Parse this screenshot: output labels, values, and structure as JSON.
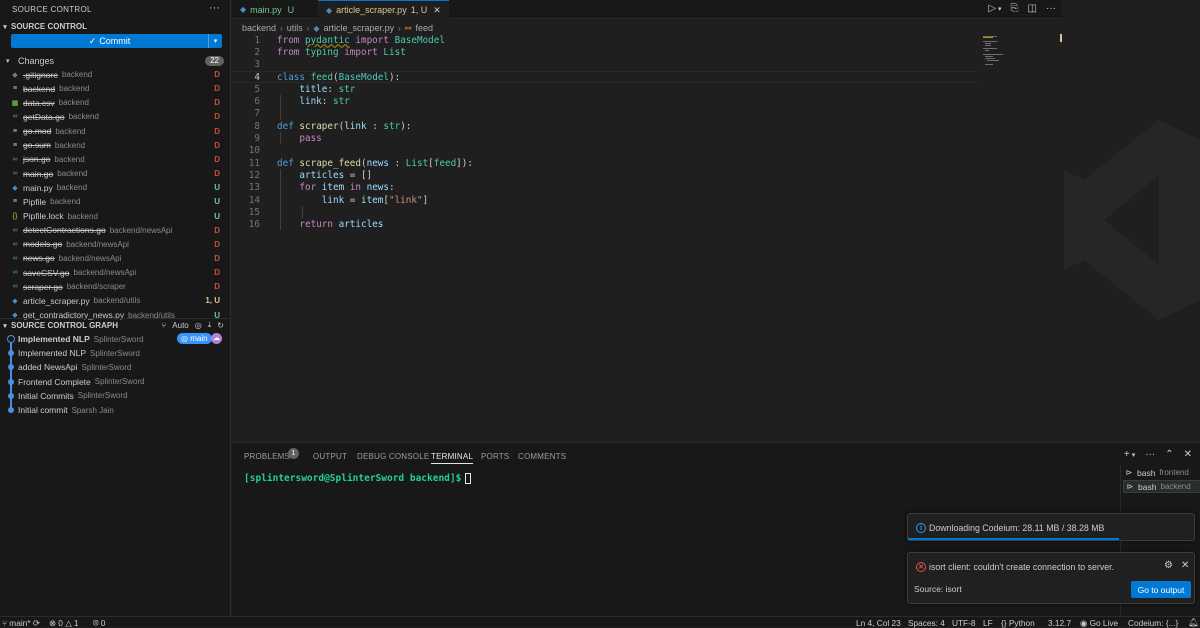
{
  "sidebar": {
    "title": "SOURCE CONTROL",
    "section_title": "SOURCE CONTROL",
    "commit_label": "Commit",
    "changes_label": "Changes",
    "changes_count": "22",
    "files": [
      {
        "icon": "gear-file-icon",
        "glyph": "◆",
        "glyph_color": "#6d8086",
        "name": ".gitignore",
        "path": "backend",
        "status": "D",
        "deleted": true
      },
      {
        "icon": "folder-file-icon",
        "glyph": "≡",
        "glyph_color": "#cccccc",
        "name": "backend",
        "path": "backend",
        "status": "D",
        "deleted": true
      },
      {
        "icon": "csv-file-icon",
        "glyph": "▦",
        "glyph_color": "#89e051",
        "name": "data.csv",
        "path": "backend",
        "status": "D",
        "deleted": true
      },
      {
        "icon": "go-file-icon",
        "glyph": "∞",
        "glyph_color": "#519aba",
        "name": "getData.go",
        "path": "backend",
        "status": "D",
        "deleted": true
      },
      {
        "icon": "mod-file-icon",
        "glyph": "≡",
        "glyph_color": "#cccccc",
        "name": "go.mod",
        "path": "backend",
        "status": "D",
        "deleted": true
      },
      {
        "icon": "sum-file-icon",
        "glyph": "≡",
        "glyph_color": "#cccccc",
        "name": "go.sum",
        "path": "backend",
        "status": "D",
        "deleted": true
      },
      {
        "icon": "go-file-icon",
        "glyph": "∞",
        "glyph_color": "#519aba",
        "name": "json.go",
        "path": "backend",
        "status": "D",
        "deleted": true
      },
      {
        "icon": "go-file-icon",
        "glyph": "∞",
        "glyph_color": "#519aba",
        "name": "main.go",
        "path": "backend",
        "status": "D",
        "deleted": true
      },
      {
        "icon": "python-file-icon",
        "glyph": "◆",
        "glyph_color": "#4b8bbe",
        "name": "main.py",
        "path": "backend",
        "status": "U",
        "deleted": false
      },
      {
        "icon": "pipfile-icon",
        "glyph": "≡",
        "glyph_color": "#cccccc",
        "name": "Pipfile",
        "path": "backend",
        "status": "U",
        "deleted": false
      },
      {
        "icon": "json-file-icon",
        "glyph": "{}",
        "glyph_color": "#cbcb41",
        "name": "Pipfile.lock",
        "path": "backend",
        "status": "U",
        "deleted": false
      },
      {
        "icon": "go-file-icon",
        "glyph": "∞",
        "glyph_color": "#519aba",
        "name": "detectContractions.go",
        "path": "backend/newsApi",
        "status": "D",
        "deleted": true
      },
      {
        "icon": "go-file-icon",
        "glyph": "∞",
        "glyph_color": "#519aba",
        "name": "models.go",
        "path": "backend/newsApi",
        "status": "D",
        "deleted": true
      },
      {
        "icon": "go-file-icon",
        "glyph": "∞",
        "glyph_color": "#519aba",
        "name": "news.go",
        "path": "backend/newsApi",
        "status": "D",
        "deleted": true
      },
      {
        "icon": "go-file-icon",
        "glyph": "∞",
        "glyph_color": "#519aba",
        "name": "saveCSV.go",
        "path": "backend/newsApi",
        "status": "D",
        "deleted": true
      },
      {
        "icon": "go-file-icon",
        "glyph": "∞",
        "glyph_color": "#519aba",
        "name": "scraper.go",
        "path": "backend/scraper",
        "status": "D",
        "deleted": true
      },
      {
        "icon": "python-file-icon",
        "glyph": "◆",
        "glyph_color": "#4b8bbe",
        "name": "article_scraper.py",
        "path": "backend/utils",
        "status": "1, U",
        "deleted": false
      },
      {
        "icon": "python-file-icon",
        "glyph": "◆",
        "glyph_color": "#4b8bbe",
        "name": "get_contradictory_news.py",
        "path": "backend/utils",
        "status": "U",
        "deleted": false
      }
    ],
    "graph_title": "SOURCE CONTROL GRAPH",
    "graph_auto": "Auto",
    "graph_branch": "main",
    "commits": [
      {
        "message": "Implemented NLP",
        "author": "SplinterSword",
        "current": true
      },
      {
        "message": "Implemented NLP",
        "author": "SplinterSword",
        "current": false
      },
      {
        "message": "added NewsApi",
        "author": "SplinterSword",
        "current": false
      },
      {
        "message": "Frontend Complete",
        "author": "SplinterSword",
        "current": false
      },
      {
        "message": "Initial Commits",
        "author": "SplinterSword",
        "current": false
      },
      {
        "message": "Initial commit",
        "author": "Sparsh Jain",
        "current": false
      }
    ]
  },
  "tabs": [
    {
      "label": "main.py",
      "suffix": "U",
      "active": false
    },
    {
      "label": "article_scraper.py",
      "suffix": "1, U",
      "active": true
    }
  ],
  "breadcrumb": [
    "backend",
    "utils",
    "article_scraper.py",
    "feed"
  ],
  "code_lines": [
    "1",
    "2",
    "3",
    "4",
    "5",
    "6",
    "7",
    "8",
    "9",
    "10",
    "11",
    "12",
    "13",
    "14",
    "15",
    "16"
  ],
  "panel": {
    "tabs": [
      "PROBLEMS",
      "OUTPUT",
      "DEBUG CONSOLE",
      "TERMINAL",
      "PORTS",
      "COMMENTS"
    ],
    "problems_count": "1",
    "active_tab": "TERMINAL",
    "prompt": "[splintersword@SplinterSword backend]$",
    "terminals": [
      {
        "name": "bash",
        "cwd": "frontend",
        "selected": false
      },
      {
        "name": "bash",
        "cwd": "backend",
        "selected": true
      }
    ]
  },
  "notifications": {
    "download": "Downloading Codeium: 28.11 MB / 38.28 MB",
    "download_progress": 0.734,
    "error": "isort client: couldn't create connection to server.",
    "source": "Source: isort",
    "button": "Go to output"
  },
  "statusbar": {
    "branch": "main*",
    "errors": "0",
    "warnings": "1",
    "ports": "0",
    "position": "Ln 4, Col 23",
    "spaces": "Spaces: 4",
    "encoding": "UTF-8",
    "eol": "LF",
    "language": "Python",
    "version": "3.12.7",
    "golive": "Go Live",
    "codeium": "Codeium: {...}"
  },
  "colors": {
    "accent": "#0078d4",
    "deleted": "#c74e39",
    "untracked": "#73c991",
    "modified": "#e2c08d"
  }
}
